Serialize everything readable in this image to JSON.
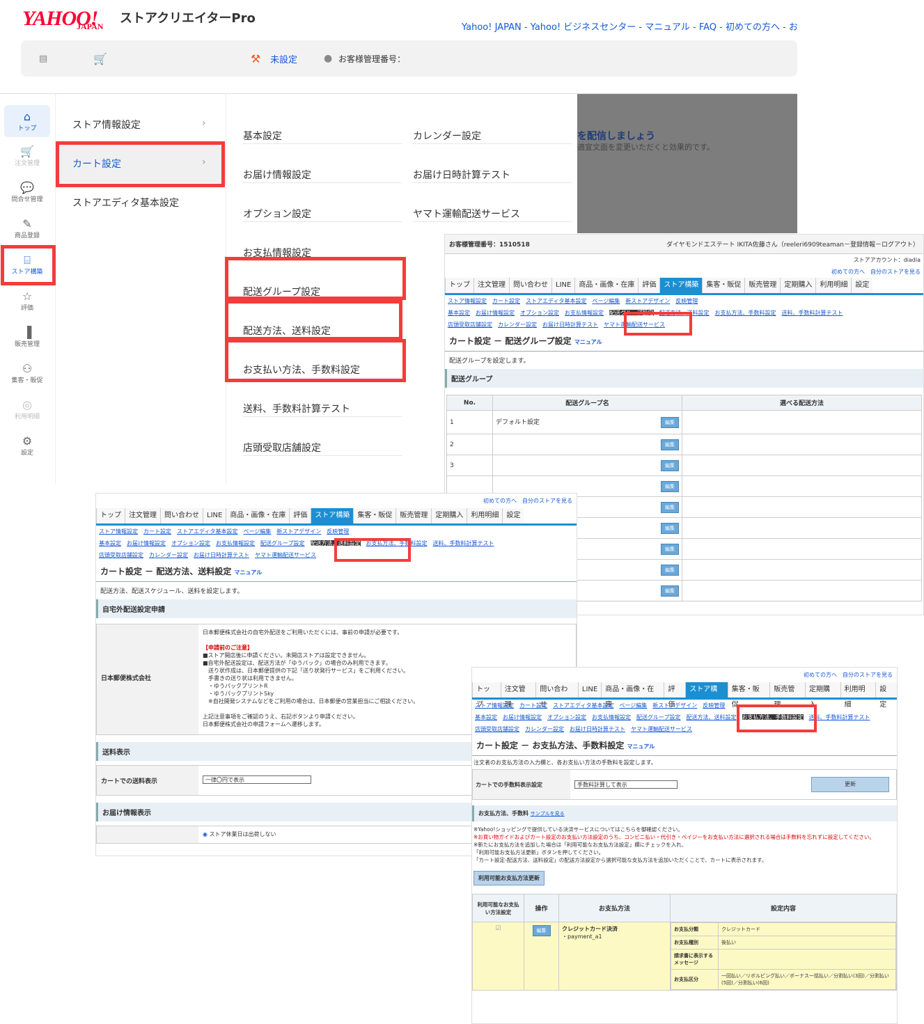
{
  "header": {
    "logo": "YAHOO!",
    "logo_sub": "JAPAN",
    "product": "ストアクリエイターPro",
    "links": "Yahoo! JAPAN - Yahoo! ビジネスセンター - マニュアル - FAQ - 初めての方へ - お"
  },
  "toolbar": {
    "status": "未設定",
    "customer_label": "お客様管理番号："
  },
  "sidebar": {
    "items": [
      {
        "label": "トップ",
        "icon": "home-icon"
      },
      {
        "label": "注文管理",
        "icon": "cart-icon"
      },
      {
        "label": "問合せ管理",
        "icon": "chat-icon"
      },
      {
        "label": "商品登録",
        "icon": "edit-icon"
      },
      {
        "label": "ストア構築",
        "icon": "store-icon"
      },
      {
        "label": "評価",
        "icon": "star-icon"
      },
      {
        "label": "販売管理",
        "icon": "chart-icon"
      },
      {
        "label": "集客・販促",
        "icon": "people-icon"
      },
      {
        "label": "利用明細",
        "icon": "coin-icon"
      },
      {
        "label": "設定",
        "icon": "gear-icon"
      }
    ]
  },
  "menu1": {
    "items": [
      "ストア情報設定",
      "カート設定",
      "ストアエディタ基本設定"
    ]
  },
  "menu2": {
    "col1": [
      "基本設定",
      "お届け情報設定",
      "オプション設定",
      "お支払情報設定",
      "配送グループ設定",
      "配送方法、送料設定",
      "お支払い方法、手数料設定",
      "送料、手数料計算テスト",
      "店頭受取店舗設定"
    ],
    "col2": [
      "カレンダー設定",
      "お届け日時計算テスト",
      "ヤマト運輸配送サービス"
    ]
  },
  "banner": {
    "line1": "を配信しましょう",
    "line2": "適宜文面を変更いただくと効果的です。"
  },
  "nav": {
    "tabs": [
      "トップ",
      "注文管理",
      "問い合わせ",
      "LINE",
      "商品・画像・在庫",
      "評価",
      "ストア構築",
      "集客・販促",
      "販売管理",
      "定期購入",
      "利用明細",
      "設定"
    ],
    "sub1": [
      "ストア情報設定",
      "カート設定",
      "ストアエディタ基本設定",
      "ページ編集",
      "新ストアデザイン",
      "反映管理"
    ],
    "sub2": [
      "基本設定",
      "お届け情報設定",
      "オプション設定",
      "お支払情報設定",
      "配送グループ設定",
      "配送方法、送料設定",
      "お支払方法、手数料設定",
      "送料、手数料計算テスト"
    ],
    "sub3": [
      "店頭受取店舗設定",
      "カレンダー設定",
      "お届け日時計算テスト",
      "ヤマト運輸配送サービス"
    ],
    "help1": "初めての方へ",
    "help2": "自分のストアを見る",
    "manual": "マニュアル"
  },
  "shot1": {
    "customer": "お客様管理番号：1510518",
    "user": "ダイヤモンドエステート IKITA佐藤さん（reeleri6909teaman－登録情報－ログアウト）",
    "account": "ストアアカウント：diadia",
    "title": "カート設定 － 配送グループ設定",
    "desc": "配送グループを設定します。",
    "band": "配送グループ",
    "cols": [
      "No.",
      "配送グループ名",
      "選べる配送方法"
    ],
    "rows": [
      {
        "no": "1",
        "name": "デフォルト設定"
      },
      {
        "no": "2",
        "name": ""
      },
      {
        "no": "3",
        "name": ""
      }
    ],
    "edit": "編集"
  },
  "shot2": {
    "title": "カート設定 － 配送方法、送料設定",
    "desc": "配送方法、配送スケジュール、送料を設定します。",
    "band1": "自宅外配送設定申請",
    "company": "日本郵便株式会社",
    "notice": [
      "日本郵便株式会社の自宅外配送をご利用いただくには、事前の申請が必要です。",
      "【申請前のご注意】",
      "■ストア開店後に申請ください。未開店ストアは設定できません。",
      "■自宅外配送設定は、配送方法が「ゆうパック」の場合のみ利用できます。",
      "　送り状作成は、日本郵便提供の下記「送り状発行サービス」をご利用ください。",
      "　手書きの送り状は利用できません。",
      "　・ゆうパックプリントR",
      "　・ゆうパックプリントSky",
      "　※自社開発システムなどをご利用の場合は、日本郵便の営業担当にご相談ください。",
      "上記注意事項をご確認のうえ、右記ボタンより申請ください。",
      "日本郵便株式会社の申請フォームへ遷移します。"
    ],
    "band2": "送料表示",
    "row_label": "カートでの送料表示",
    "select": "一律〇円で表示",
    "band3": "お届け情報表示",
    "radio": "ストア休業日は出荷しない"
  },
  "shot3": {
    "title": "カート設定 － お支払方法、手数料設定",
    "desc": "注文者のお支払方法の入力欄と、各お支払い方法の手数料を設定します。",
    "row_label": "カートでの手数料表示設定",
    "select": "手数料計算して表示",
    "update": "更新",
    "band": "お支払方法、手数料",
    "sample": "サンプルを見る",
    "notes": [
      "※Yahoo!ショッピングで提供している決済サービスについてはこちらを御確認ください。",
      "※お買い物ガイドおよびカート設定のお支払い方法設定のうち、コンビニ払い・代引き・ペイジーをお支払い方法に選択される場合は手数料を忘れずに設定してください。",
      "※新たにお支払方法を追加した場合は「利用可能なお支払方法設定」欄にチェックを入れ、",
      "「利用可能お支払方法更新」ボタンを押してください。",
      "「カート設定-配送方法、送料設定」の配送方法設定から選択可能な支払方法を追加いただくことで、カートに表示されます。"
    ],
    "btn": "利用可能お支払方法更新",
    "cols": [
      "利用可能なお支払い方法設定",
      "操作",
      "お支払方法",
      "設定内容"
    ],
    "method": "クレジットカード決済",
    "method_id": "・payment_a1",
    "edit": "編集",
    "kv": [
      {
        "k": "お支払分類",
        "v": "クレジットカード"
      },
      {
        "k": "お支払種別",
        "v": "後払い"
      },
      {
        "k": "請求書に表示するメッセージ",
        "v": ""
      },
      {
        "k": "お支払区分",
        "v": "一回払い／リボルビング払い／ボーナス一括払い／分割払い(3回)／分割払い(5回)／分割払い(6回)"
      }
    ]
  }
}
